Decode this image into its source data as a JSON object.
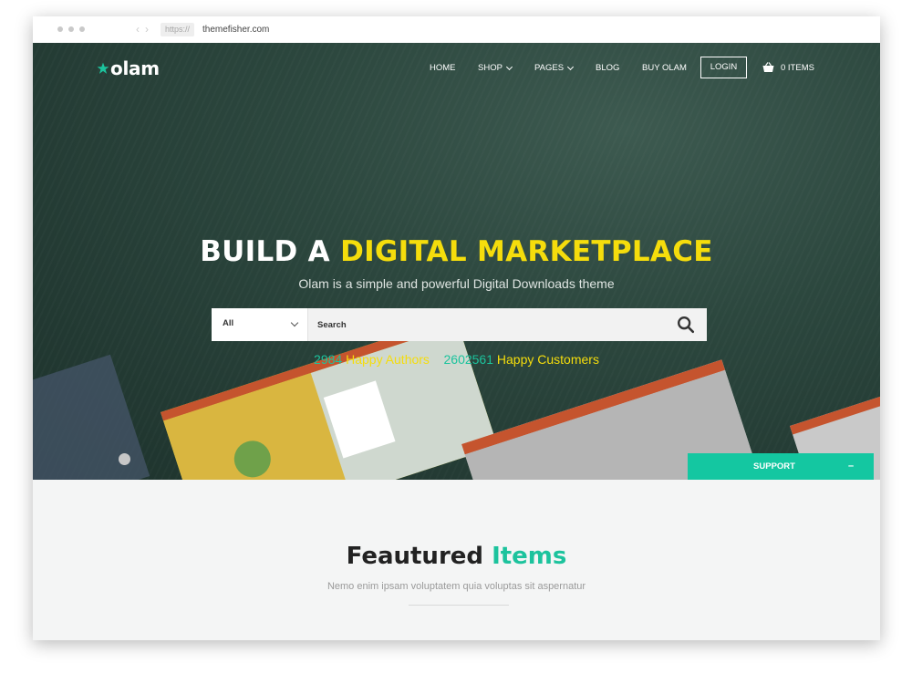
{
  "browser": {
    "protocol": "https://",
    "url": "themefisher.com",
    "back_arrow": "‹",
    "forward_arrow": "›"
  },
  "header": {
    "logo_text": "olam",
    "nav": {
      "home": "HOME",
      "shop": "SHOP",
      "pages": "PAGES",
      "blog": "BLOG",
      "buy": "BUY OLAM",
      "login": "LOGIN",
      "cart": "0 ITEMS"
    }
  },
  "hero": {
    "headline_white": "BUILD A ",
    "headline_yellow": "DIGITAL MARKETPLACE",
    "subheading": "Olam is a simple and powerful Digital Downloads theme",
    "search": {
      "category_selected": "All",
      "placeholder": "Search"
    },
    "stats": {
      "authors_count": "2984",
      "authors_label": "Happy Authors",
      "customers_count": "2602561",
      "customers_label": "Happy Customers"
    },
    "support_label": "SUPPORT",
    "support_toggle": "–"
  },
  "featured": {
    "title_dark": "Feautured ",
    "title_green": "Items",
    "subtitle": "Nemo enim ipsam voluptatem quia voluptas sit aspernatur"
  },
  "colors": {
    "accent_green": "#1cc39d",
    "accent_yellow": "#f5dd0c",
    "hero_bg": "#2c473e",
    "support_bg": "#14c7a1"
  },
  "icons": {
    "logo": "star-icon",
    "select": "chevron-down-icon",
    "search": "search-icon",
    "cart": "basket-icon"
  }
}
